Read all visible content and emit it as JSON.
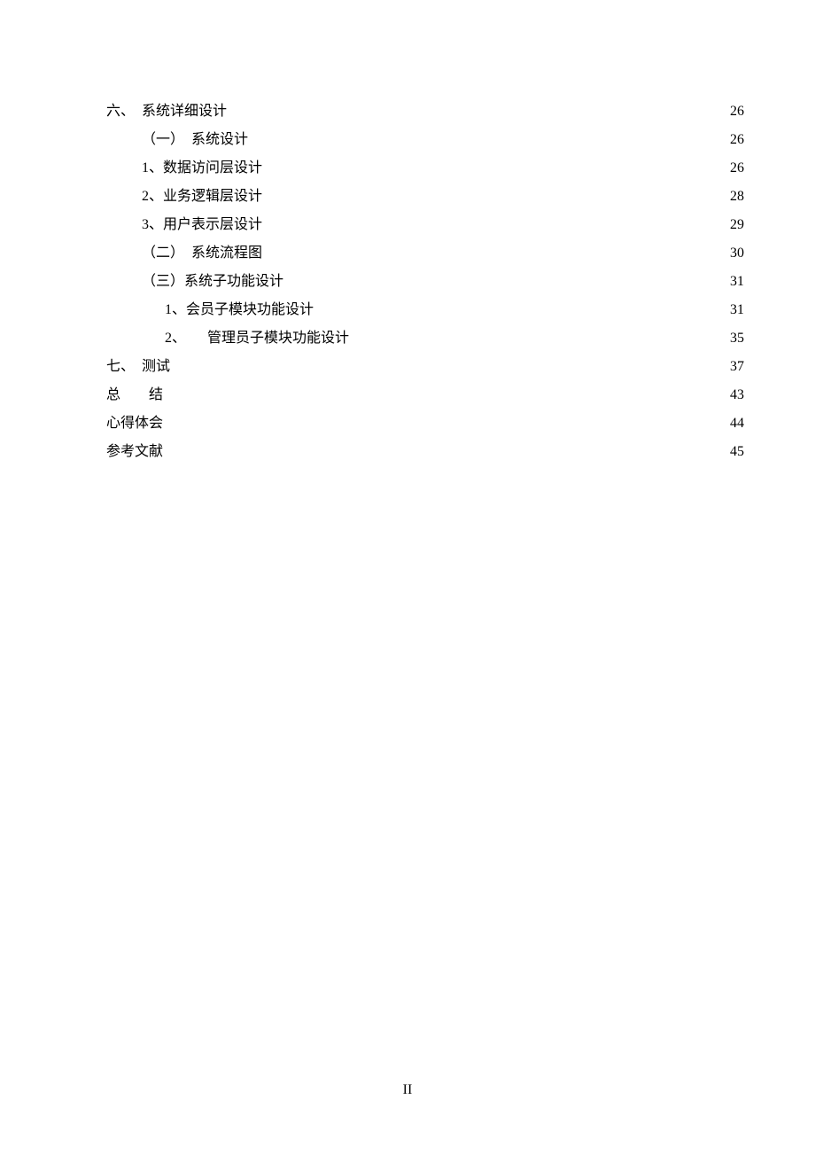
{
  "toc": {
    "entries": [
      {
        "level": "l0",
        "title": "六、　系统详细设计",
        "page": "26"
      },
      {
        "level": "l1",
        "title": "（一）　系统设计",
        "page": "26"
      },
      {
        "level": "l2",
        "title": "1、数据访问层设计",
        "page": "26"
      },
      {
        "level": "l2",
        "title": "2、业务逻辑层设计",
        "page": "28"
      },
      {
        "level": "l2",
        "title": "3、用户表示层设计",
        "page": "29"
      },
      {
        "level": "l1",
        "title": "（二）　系统流程图",
        "page": "30"
      },
      {
        "level": "l1",
        "title": "（三）系统子功能设计",
        "page": "31"
      },
      {
        "level": "l3",
        "title": "1、会员子模块功能设计",
        "page": "31"
      },
      {
        "level": "l3",
        "title": "2、　　管理员子模块功能设计",
        "page": "35"
      },
      {
        "level": "l0",
        "title": "七、　测试",
        "page": "37"
      },
      {
        "level": "l0",
        "title": "<span class=\"spaced-title\">总结</span>",
        "raw_title": "总　　结",
        "page": "43"
      },
      {
        "level": "l0",
        "title": "心得体会",
        "page": "44"
      },
      {
        "level": "l0",
        "title": "参考文献",
        "page": "45"
      }
    ]
  },
  "footer": {
    "page_label": "II"
  }
}
